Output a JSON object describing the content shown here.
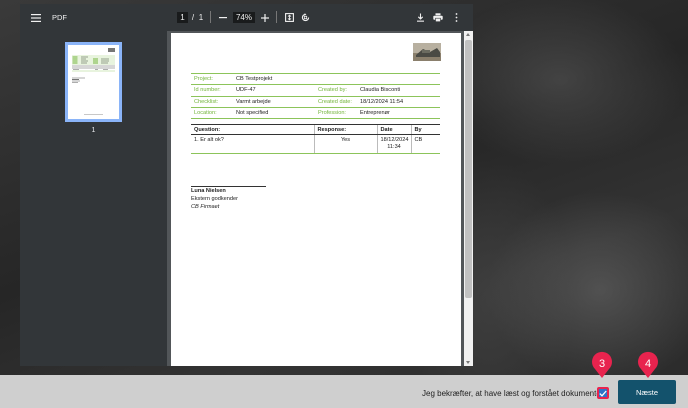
{
  "viewer": {
    "title": "PDF",
    "page_current": "1",
    "page_separator": "/",
    "page_total": "1",
    "zoom": "74%",
    "thumbnail_label": "1",
    "icons": [
      "menu-icon",
      "zoom-out-icon",
      "zoom-in-icon",
      "fit-page-icon",
      "rotate-icon",
      "download-icon",
      "print-icon",
      "more-icon"
    ]
  },
  "document": {
    "info_rows": [
      {
        "label1": "Project:",
        "value1": "CB Testprojekt",
        "label2": "",
        "value2": ""
      },
      {
        "label1": "Id number:",
        "value1": "UDF-47",
        "label2": "Created by:",
        "value2": "Claudia Bisconti"
      },
      {
        "label1": "Checklist:",
        "value1": "Varmt arbejde",
        "label2": "Created date:",
        "value2": "18/12/2024 11:54"
      },
      {
        "label1": "Location:",
        "value1": "Not specified",
        "label2": "Profession:",
        "value2": "Entreprenør"
      }
    ],
    "questions_header": {
      "question": "Question:",
      "response": "Response:",
      "date": "Date",
      "by": "By"
    },
    "questions": [
      {
        "question": "1. Er alt ok?",
        "response": "Yes",
        "date": "18/12/2024",
        "time": "11:34",
        "by": "CB"
      }
    ],
    "signature": {
      "name": "Luna Nielsen",
      "role": "Ekstern godkender",
      "company": "CB Firmaet"
    }
  },
  "footer": {
    "confirm_text": "Jeg bekræfter, at have læst og forstået dokumentet",
    "checkbox_checked": true,
    "next_label": "Næste"
  },
  "markers": [
    "3",
    "4"
  ],
  "colors": {
    "accent_green": "#72b43a",
    "next_button": "#13526c",
    "checkbox_blue": "#2f72c8",
    "marker_red": "#e8234e"
  }
}
